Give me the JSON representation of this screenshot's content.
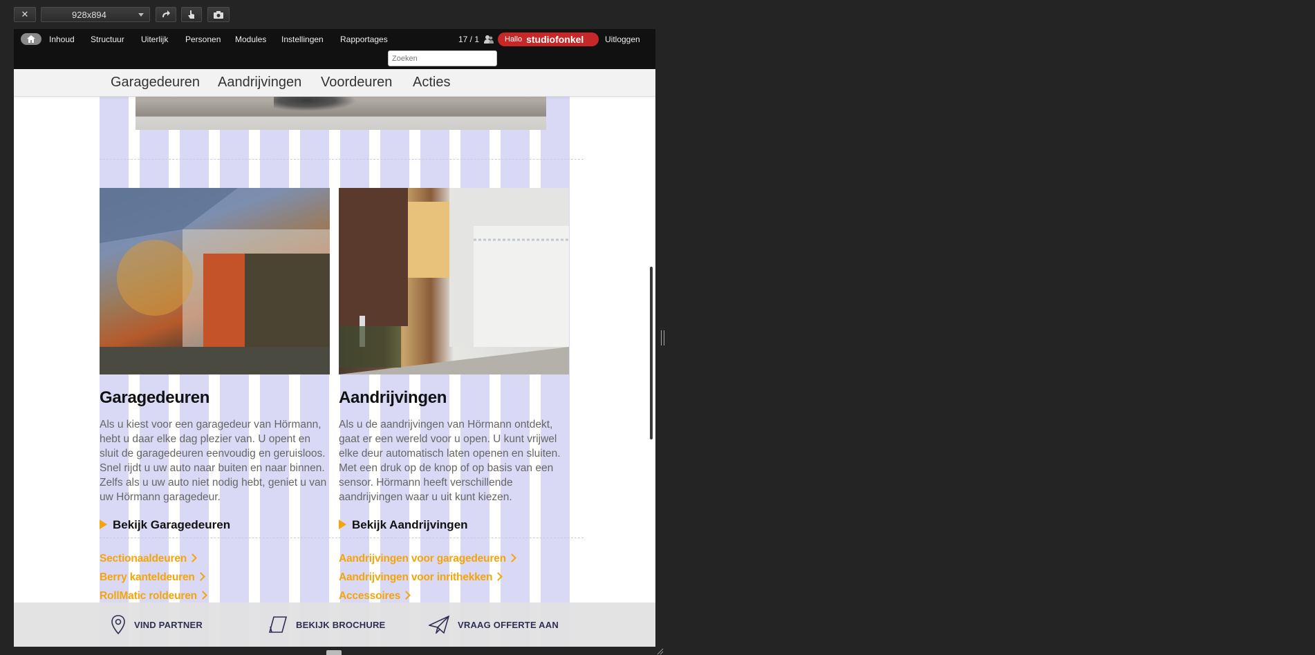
{
  "toolbar": {
    "close_label": "✕",
    "size_label": "928x894",
    "rotate_icon": "rotate-icon",
    "touch_icon": "touch-icon",
    "camera_icon": "camera-icon"
  },
  "admin_bar": {
    "nav": [
      "Inhoud",
      "Structuur",
      "Uiterlijk",
      "Personen",
      "Modules",
      "Instellingen",
      "Rapportages"
    ],
    "counter": "17 / 1",
    "greeting": "Hallo",
    "username": "studiofonkel",
    "logout": "Uitloggen",
    "search_placeholder": "Zoeken"
  },
  "site_nav": [
    "Garagedeuren",
    "Aandrijvingen",
    "Voordeuren",
    "Acties"
  ],
  "sections": [
    {
      "title": "Garagedeuren",
      "text": "Als u kiest voor een garagedeur van Hörmann, hebt u daar elke dag plezier van. U opent en sluit de garagedeuren eenvoudig en geruisloos. Snel rijdt u uw auto naar buiten en naar binnen. Zelfs als u uw auto niet nodig hebt, geniet u van uw Hörmann garagedeur.",
      "cta": "Bekijk Garagedeuren",
      "links": [
        "Sectionaaldeuren",
        "Berry kanteldeuren",
        "RollMatic roldeuren"
      ]
    },
    {
      "title": "Aandrijvingen",
      "text": "Als u de aandrijvingen van Hörmann ontdekt, gaat er een wereld voor u open. U kunt vrijwel elke deur automatisch laten openen en sluiten. Met een druk op de knop of op basis van een sensor. Hörmann heeft verschillende aandrijvingen waar u uit kunt kiezen.",
      "cta": "Bekijk Aandrijvingen",
      "links": [
        "Aandrijvingen voor garagedeuren",
        "Aandrijvingen voor inrithekken",
        "Accessoires"
      ]
    }
  ],
  "footer": [
    "VIND PARTNER",
    "BEKIJK BROCHURE",
    "VRAAG OFFERTE AAN"
  ],
  "colors": {
    "accent": "#f3a50b",
    "admin_red": "#c62828",
    "grid_overlay": "#d9d9f5",
    "footer_text": "#2e2e52"
  }
}
